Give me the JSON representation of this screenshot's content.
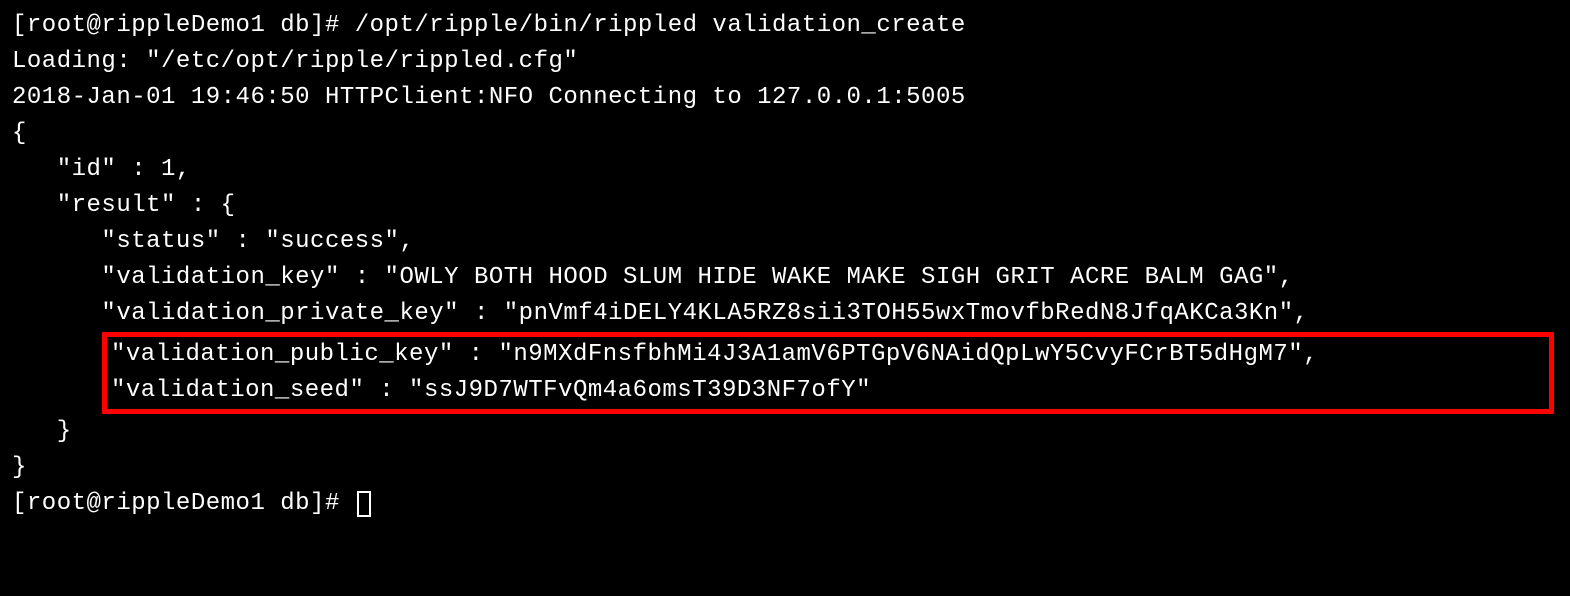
{
  "terminal": {
    "line1": "[root@rippleDemo1 db]# /opt/ripple/bin/rippled validation_create",
    "line2": "Loading: \"/etc/opt/ripple/rippled.cfg\"",
    "line3": "2018-Jan-01 19:46:50 HTTPClient:NFO Connecting to 127.0.0.1:5005",
    "line4": "",
    "line5": "{",
    "line6": "   \"id\" : 1,",
    "line7": "   \"result\" : {",
    "line8": "      \"status\" : \"success\",",
    "line9": "      \"validation_key\" : \"OWLY BOTH HOOD SLUM HIDE WAKE MAKE SIGH GRIT ACRE BALM GAG\",",
    "line10": "      \"validation_private_key\" : \"pnVmf4iDELY4KLA5RZ8sii3TOH55wxTmovfbRedN8JfqAKCa3Kn\",",
    "highlighted1": "\"validation_public_key\" : \"n9MXdFnsfbhMi4J3A1amV6PTGpV6NAidQpLwY5CvyFCrBT5dHgM7\",",
    "highlighted2": "\"validation_seed\" : \"ssJ9D7WTFvQm4a6omsT39D3NF7ofY\"",
    "line11": "   }",
    "line12": "}",
    "prompt": "[root@rippleDemo1 db]# "
  }
}
